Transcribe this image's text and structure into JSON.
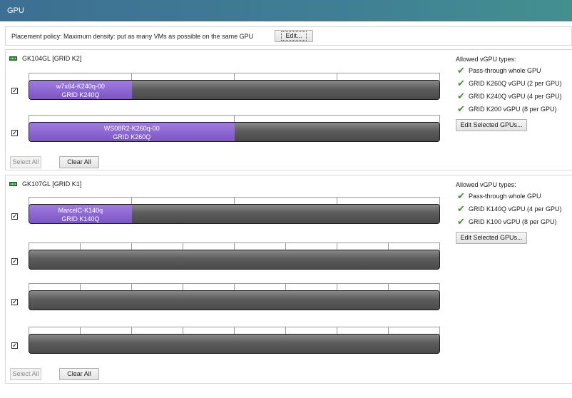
{
  "title": "GPU",
  "policy": {
    "text": "Placement policy: Maximum density: put as many VMs as possible on the same GPU",
    "edit_label": "Edit..."
  },
  "groups": [
    {
      "name": "GK104GL [GRID K2]",
      "allowed_header": "Allowed vGPU types:",
      "allowed": [
        "Pass-through whole GPU",
        "GRID K260Q vGPU (2 per GPU)",
        "GRID K240Q vGPU (4 per GPU)",
        "GRID K200 vGPU (8 per GPU)"
      ],
      "edit_selected_label": "Edit Selected GPUs...",
      "select_all_label": "Select All",
      "clear_all_label": "Clear All",
      "gpus": [
        {
          "checked": true,
          "vm_name": "w7x64-K240q-00",
          "vm_type": "GRID K240Q",
          "fill": 0.25
        },
        {
          "checked": true,
          "vm_name": "WS08R2-K260q-00",
          "vm_type": "GRID K260Q",
          "fill": 0.5
        }
      ]
    },
    {
      "name": "GK107GL [GRID K1]",
      "allowed_header": "Allowed vGPU types:",
      "allowed": [
        "Pass-through whole GPU",
        "GRID K140Q vGPU (4 per GPU)",
        "GRID K100 vGPU (8 per GPU)"
      ],
      "edit_selected_label": "Edit Selected GPUs...",
      "select_all_label": "Select All",
      "clear_all_label": "Clear All",
      "gpus": [
        {
          "checked": true,
          "vm_name": "MarcelC-K140q",
          "vm_type": "GRID K140Q",
          "fill": 0.25
        },
        {
          "checked": true
        },
        {
          "checked": true
        },
        {
          "checked": true
        }
      ]
    }
  ]
}
